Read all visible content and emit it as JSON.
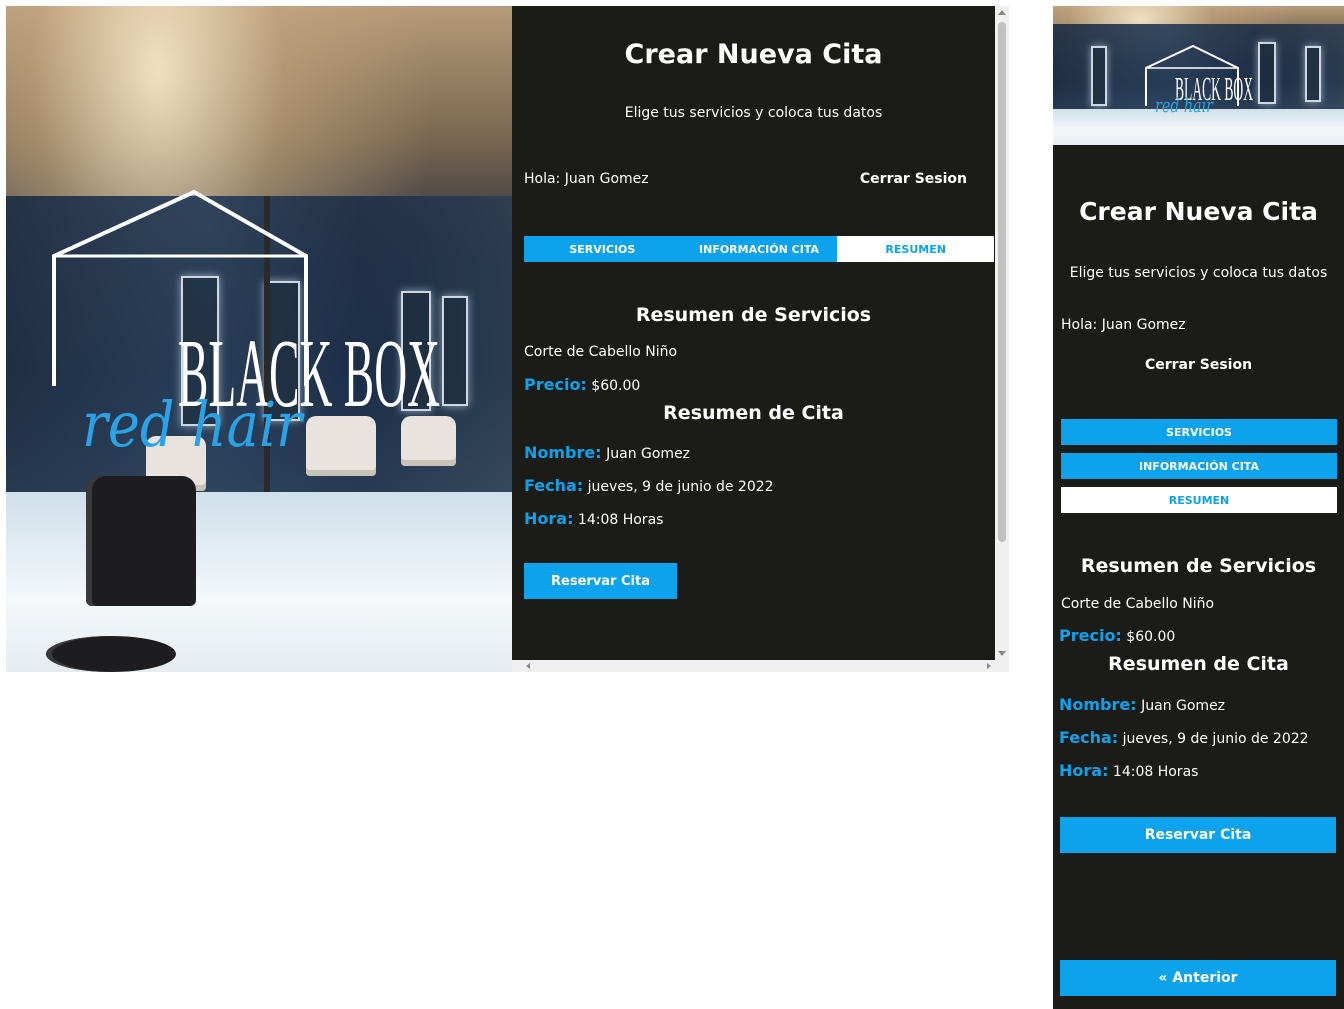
{
  "colors": {
    "accent": "#0da2ec",
    "panel_bg": "#1b1c18",
    "text": "#ffffff"
  },
  "logo": {
    "brand": "BLACK BOX",
    "script": "red hair"
  },
  "header": {
    "title": "Crear Nueva Cita",
    "subtitle": "Elige tus servicios y coloca tus datos"
  },
  "session": {
    "greeting": "Hola: Juan Gomez",
    "logout_label": "Cerrar Sesion"
  },
  "tabs": [
    {
      "label": "SERVICIOS",
      "active": false
    },
    {
      "label": "INFORMACIÓN CITA",
      "active": false
    },
    {
      "label": "RESUMEN",
      "active": true
    }
  ],
  "summary": {
    "services_heading": "Resumen de Servicios",
    "service_name": "Corte de Cabello Niño",
    "price_label": "Precio:",
    "price_value": "$60.00",
    "appointment_heading": "Resumen de Cita",
    "name_label": "Nombre:",
    "name_value": "Juan Gomez",
    "date_label": "Fecha:",
    "date_value": "jueves, 9 de junio de 2022",
    "time_label": "Hora:",
    "time_value": "14:08 Horas"
  },
  "actions": {
    "reserve_label": "Reservar Cita",
    "previous_label": "« Anterior"
  }
}
